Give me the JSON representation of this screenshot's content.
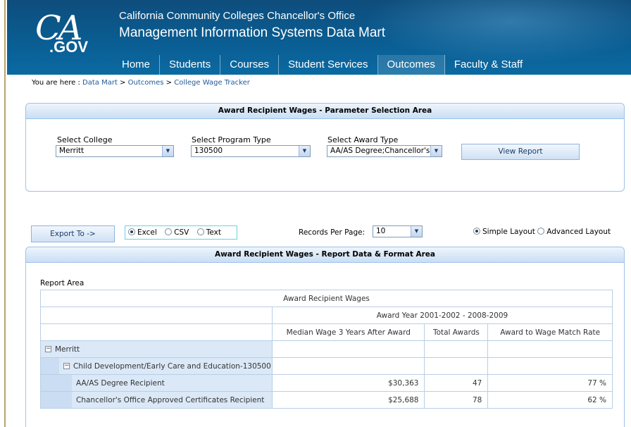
{
  "header": {
    "logo_ca": "CA",
    "logo_gov": ".GOV",
    "org_name": "California Community Colleges Chancellor's Office",
    "app_name": "Management Information Systems Data Mart",
    "nav": [
      "Home",
      "Students",
      "Courses",
      "Student Services",
      "Outcomes",
      "Faculty & Staff"
    ],
    "active_nav": "Outcomes"
  },
  "breadcrumb": {
    "prefix": "You are here : ",
    "items": [
      "Data Mart",
      "Outcomes",
      "College Wage Tracker"
    ],
    "separator": " > "
  },
  "parameters": {
    "title": "Award Recipient Wages - Parameter Selection Area",
    "college_label": "Select College",
    "college_value": "Merritt",
    "program_label": "Select Program Type",
    "program_value": "130500",
    "award_label": "Select Award Type",
    "award_value": "AA/AS Degree;Chancellor's",
    "view_button": "View Report"
  },
  "export": {
    "button": "Export To ->",
    "options": [
      "Excel",
      "CSV",
      "Text"
    ],
    "selected": "Excel"
  },
  "records": {
    "label": "Records Per Page:",
    "value": "10"
  },
  "layout": {
    "options": [
      "Simple Layout",
      "Advanced Layout"
    ],
    "selected": "Simple Layout"
  },
  "report": {
    "title": "Award Recipient Wages - Report Data & Format Area",
    "area_label": "Report Area",
    "table_title": "Award Recipient Wages",
    "year_header": "Award Year 2001-2002 - 2008-2009",
    "columns": [
      "Median Wage 3 Years After Award",
      "Total Awards",
      "Award to Wage Match Rate"
    ],
    "college": "Merritt",
    "program": "Child Development/Early Care and Education-130500",
    "rows": [
      {
        "label": "AA/AS Degree Recipient",
        "wage": "$30,363",
        "awards": "47",
        "rate": "77 %"
      },
      {
        "label": "Chancellor's Office Approved Certificates Recipient",
        "wage": "$25,688",
        "awards": "78",
        "rate": "62 %"
      }
    ]
  },
  "colors": {
    "header_blue": "#0a5d92",
    "panel_border": "#9ec2e6",
    "link": "#1f5a9a",
    "group_fill": "#dbe8f7"
  },
  "icons": {
    "dropdown": "chevron-down-icon",
    "collapse": "minus-toggle-icon"
  }
}
